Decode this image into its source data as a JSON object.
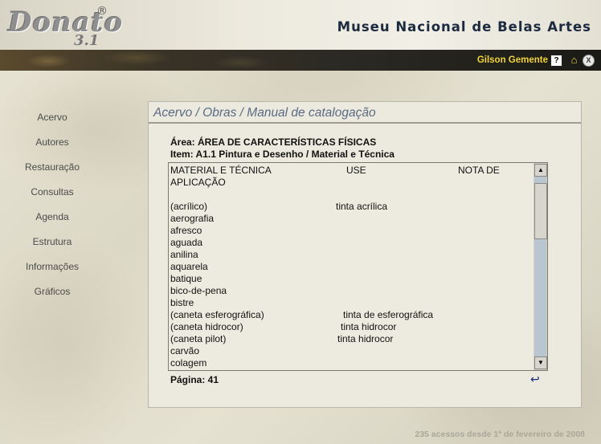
{
  "logo": {
    "word": "Donato",
    "registered": "®",
    "version": "3.1"
  },
  "header": {
    "museum_title": "Museu Nacional de Belas Artes"
  },
  "toolbar": {
    "user_name": "Gilson Gemente",
    "help_glyph": "?",
    "home_glyph": "⌂",
    "exit_glyph": "X"
  },
  "nav": {
    "items": [
      {
        "label": "Acervo"
      },
      {
        "label": "Autores"
      },
      {
        "label": "Restauração"
      },
      {
        "label": "Consultas"
      },
      {
        "label": "Agenda"
      },
      {
        "label": "Estrutura"
      },
      {
        "label": "Informações"
      },
      {
        "label": "Gráficos"
      }
    ]
  },
  "panel": {
    "breadcrumb": "Acervo / Obras / Manual de catalogação",
    "area": "Área: ÁREA DE CARACTERÍSTICAS FÍSICAS",
    "item": "Item: A1.1   Pintura e Desenho / Material e Técnica",
    "page_label": "Página: 41",
    "back_glyph": "↩"
  },
  "textbox": {
    "header": {
      "c1": "MATERIAL E TÉCNICA",
      "c2": "USE",
      "c3": "NOTA DE"
    },
    "header_wrap": "APLICAÇÃO",
    "rows": [
      {
        "c1": "(acrílico)",
        "c2": "tinta acrílica"
      },
      {
        "c1": "aerografia",
        "c2": ""
      },
      {
        "c1": "afresco",
        "c2": ""
      },
      {
        "c1": "aguada",
        "c2": ""
      },
      {
        "c1": "anilina",
        "c2": ""
      },
      {
        "c1": "aquarela",
        "c2": ""
      },
      {
        "c1": "batique",
        "c2": ""
      },
      {
        "c1": "bico-de-pena",
        "c2": ""
      },
      {
        "c1": "bistre",
        "c2": ""
      },
      {
        "c1": "(caneta esferográfica)",
        "c2": "tinta de esferográfica"
      },
      {
        "c1": "(caneta hidrocor)",
        "c2": "tinta hidrocor"
      },
      {
        "c1": "(caneta pilot)",
        "c2": "tinta hidrocor"
      },
      {
        "c1": "carvão",
        "c2": ""
      },
      {
        "c1": "colagem",
        "c2": ""
      }
    ],
    "scroll_up_glyph": "▲",
    "scroll_down_glyph": "▼",
    "scroll_position": 0.05
  },
  "footer": {
    "note": "235 acessos desde 1º de fevereiro de 2008"
  }
}
